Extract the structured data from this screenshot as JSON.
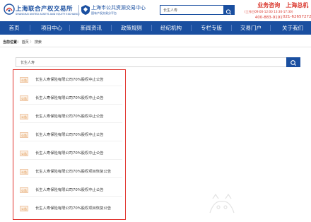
{
  "header": {
    "logo1_name": "上海联合产权交易所",
    "logo1_sub": "SHANGHAI UNITED ASSETS AND EQUITY EXCHANGE",
    "logo2_name": "上海市公共资源交易中心",
    "logo2_sub": "国有产权交易分平台",
    "search_value": "长生人寿",
    "contact_left": {
      "title": "业务咨询",
      "hours": "(工作日09:00-12:00 13:30-17:30)",
      "phone": "400-883-9191"
    },
    "contact_right": {
      "title": "上海总机",
      "phone": "021-62657272"
    }
  },
  "nav": {
    "items": [
      "首页",
      "项目中心",
      "新闻资讯",
      "政策规则",
      "经纪机构",
      "专栏专版",
      "交易门户",
      "关于我们"
    ]
  },
  "breadcrumb": {
    "label": "当前位置：",
    "home": "首页",
    "sep1": "〉",
    "current": "搜索"
  },
  "search": {
    "value": "长生人寿"
  },
  "results": [
    {
      "tag": "公告",
      "title": "长生人寿保险有限公司70%股权中止公告"
    },
    {
      "tag": "公告",
      "title": "长生人寿保险有限公司70%股权中止公告"
    },
    {
      "tag": "公告",
      "title": "长生人寿保险有限公司70%股权中止公告"
    },
    {
      "tag": "公告",
      "title": "长生人寿保险有限公司70%股权中止公告"
    },
    {
      "tag": "公告",
      "title": "长生人寿保险有限公司70%股权中止公告"
    },
    {
      "tag": "公告",
      "title": "长生人寿保险有限公司70%股权项目恢复公告"
    },
    {
      "tag": "公告",
      "title": "长生人寿保险有限公司70%股权中止公告"
    },
    {
      "tag": "公告",
      "title": "长生人寿保险有限公司70%股权项目恢复公告"
    }
  ],
  "colors": {
    "brand": "#1a4fa0",
    "accent_red": "#d9352b",
    "tag_orange": "#d9822b",
    "highlight_border": "#e0322c"
  },
  "icons": [
    "sufe-logo-icon",
    "shanghai-emblem-icon",
    "search-icon",
    "watermark-icon"
  ]
}
